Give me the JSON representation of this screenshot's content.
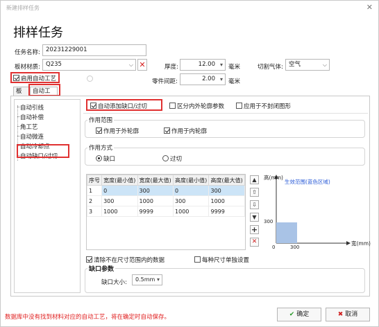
{
  "window": {
    "title": "新建排样任务",
    "close_glyph": "✕"
  },
  "heading": "排样任务",
  "form": {
    "task_name_label": "任务名称:",
    "task_name_value": "20231229001",
    "material_label": "板材材质:",
    "material_value": "Q235",
    "thickness_label": "厚度:",
    "thickness_value": "12.00",
    "thickness_unit": "毫米",
    "gas_label": "切割气体:",
    "gas_value": "空气",
    "spacing_label": "零件间距:",
    "spacing_value": "2.00",
    "spacing_unit": "毫米",
    "auto_process_label": "启用自动工艺"
  },
  "tabs": [
    {
      "label": "板材"
    },
    {
      "label": "自动工艺"
    }
  ],
  "tree": {
    "items": [
      {
        "label": "自动引线"
      },
      {
        "label": "自动补偿"
      },
      {
        "label": "角工艺"
      },
      {
        "label": "自动微连"
      },
      {
        "label": "自动冷却点"
      },
      {
        "label": "自动缺口/过切"
      }
    ]
  },
  "options": {
    "auto_add_label": "自动添加缺口/过切",
    "distinguish_label": "区分内外轮廓参数",
    "non_closed_label": "应用于不封闭图形"
  },
  "scope": {
    "title": "作用范围",
    "outer_label": "作用于外轮廓",
    "inner_label": "作用于内轮廓"
  },
  "mode": {
    "title": "作用方式",
    "notch_label": "缺口",
    "overcut_label": "过切"
  },
  "table": {
    "headers": [
      "序号",
      "宽度(最小值)",
      "宽度(最大值)",
      "高度(最小值)",
      "高度(最大值)"
    ],
    "rows": [
      [
        "1",
        "0",
        "300",
        "0",
        "300"
      ],
      [
        "2",
        "300",
        "1000",
        "300",
        "1000"
      ],
      [
        "3",
        "1000",
        "9999",
        "1000",
        "9999"
      ]
    ]
  },
  "side_buttons": [
    "▲",
    "⇧",
    "⇩",
    "▼",
    "+",
    "✕"
  ],
  "diagram": {
    "y_label": "高(mm)",
    "caption": "生效范围(蓝色区域)",
    "x_label": "宽(mm)",
    "tick_300_y": "300",
    "origin": "0",
    "tick_300_x": "300",
    "range": {
      "width_min": 0,
      "width_max": 300,
      "height_min": 0,
      "height_max": 300
    }
  },
  "extra_options": {
    "clear_label": "清除不在尺寸范围内的数据",
    "per_size_label": "每种尺寸单独设置"
  },
  "notch_params": {
    "title": "缺口参数",
    "size_label": "缺口大小:",
    "size_value": "0.5mm"
  },
  "footer": {
    "message": "数据库中没有找到材料对应的自动工艺，将在确定时自动保存。",
    "ok_label": "确定",
    "cancel_label": "取消"
  },
  "colors": {
    "highlight": "#e03030",
    "range_fill": "#a9c3e6",
    "link_blue": "#2a5bd7"
  }
}
